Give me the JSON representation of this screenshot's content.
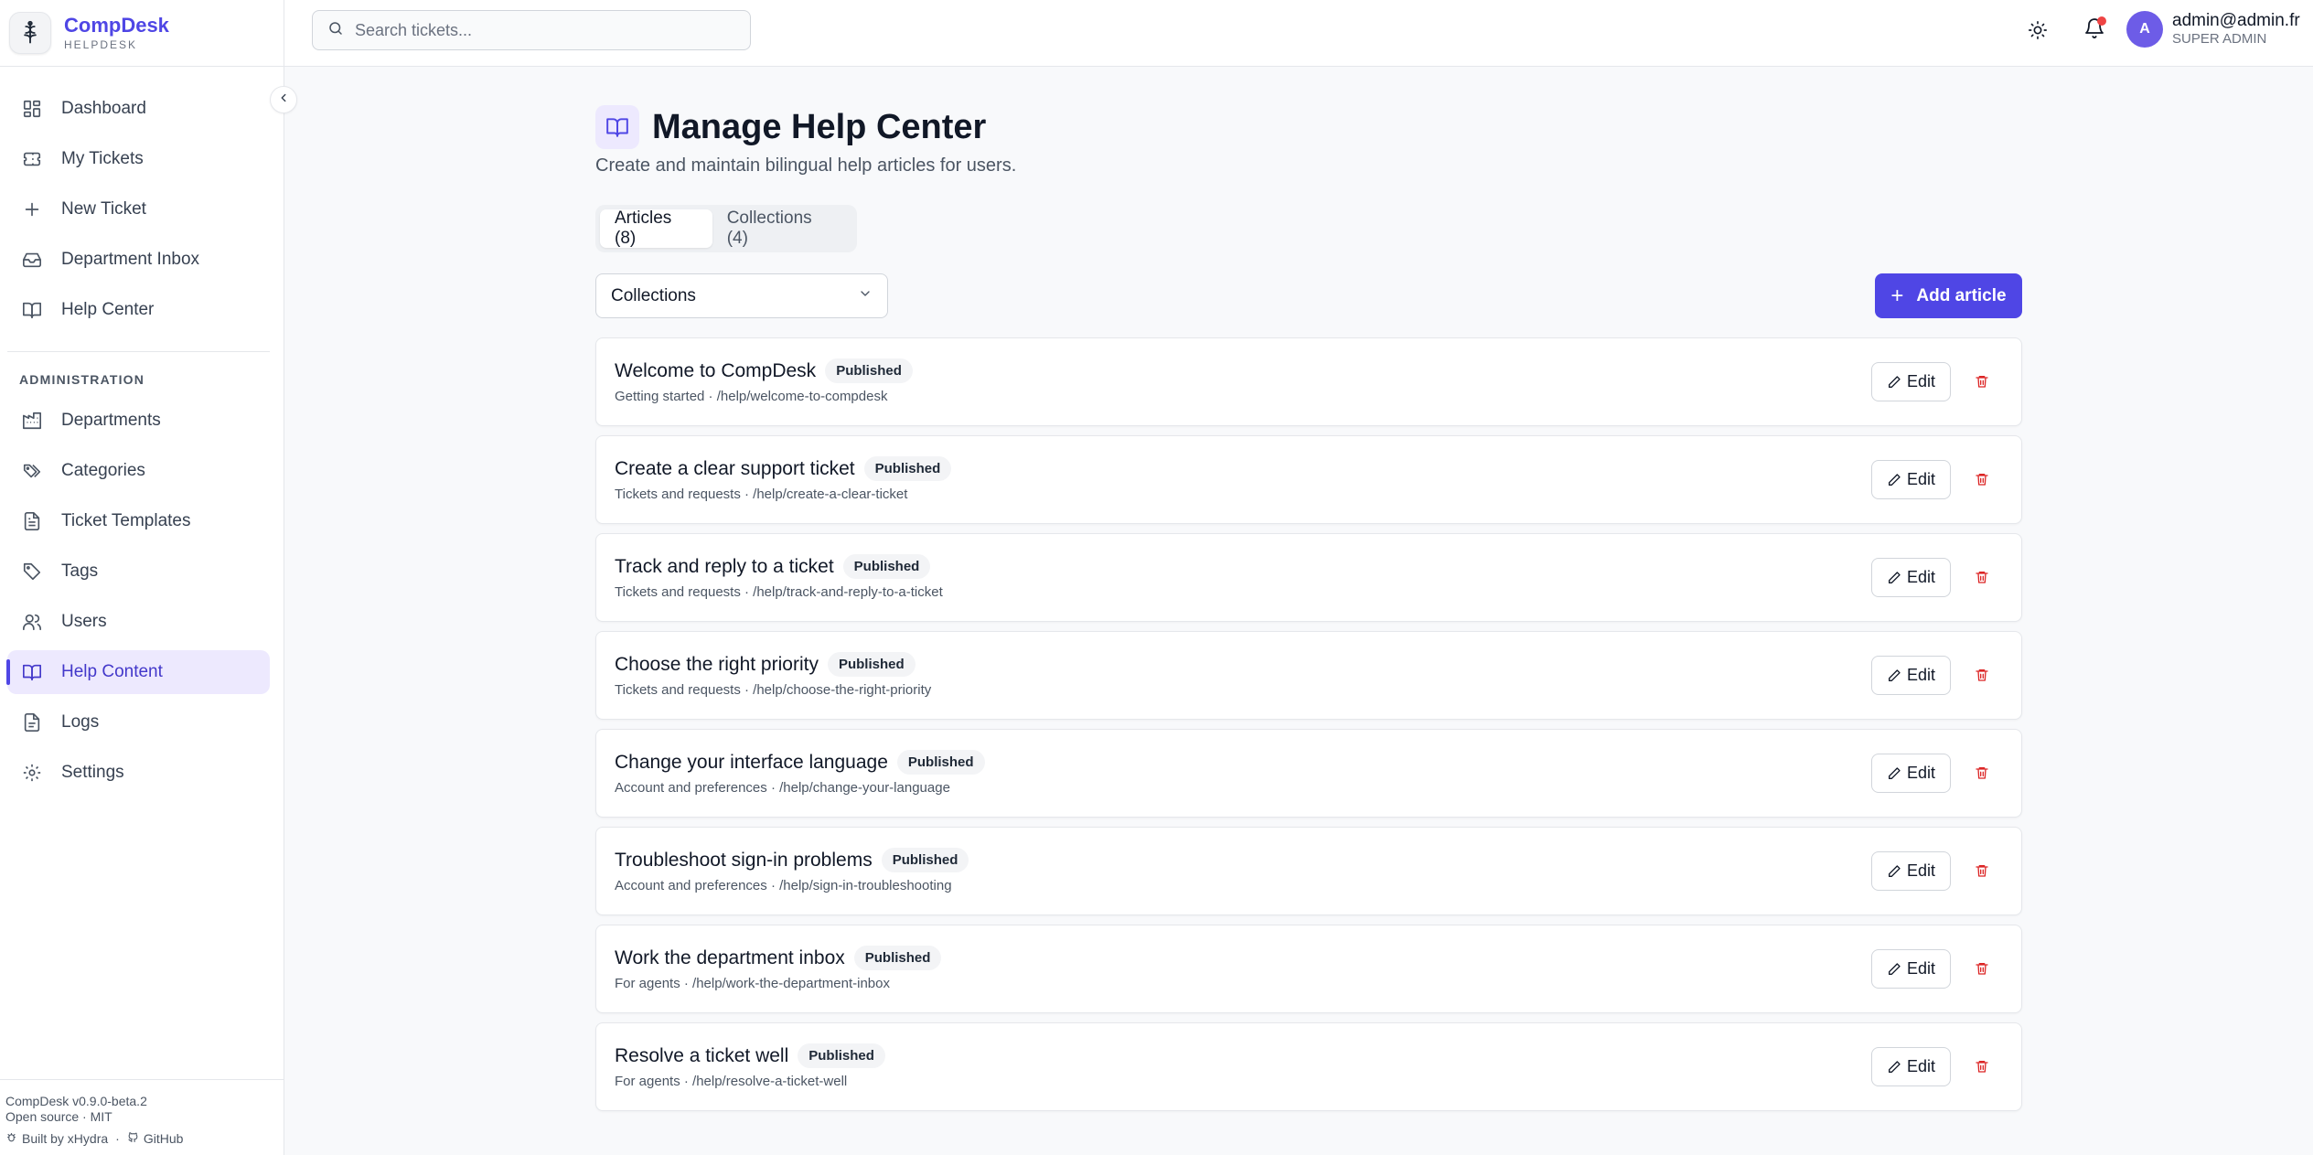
{
  "brand": {
    "name": "CompDesk",
    "subtitle": "HELPDESK"
  },
  "nav": {
    "main": [
      {
        "label": "Dashboard",
        "icon": "dashboard-icon"
      },
      {
        "label": "My Tickets",
        "icon": "ticket-icon"
      },
      {
        "label": "New Ticket",
        "icon": "plus-icon"
      },
      {
        "label": "Department Inbox",
        "icon": "inbox-icon"
      },
      {
        "label": "Help Center",
        "icon": "book-open-icon"
      }
    ],
    "section_label": "ADMINISTRATION",
    "admin": [
      {
        "label": "Departments",
        "icon": "building-icon"
      },
      {
        "label": "Categories",
        "icon": "tags-icon"
      },
      {
        "label": "Ticket Templates",
        "icon": "file-text-icon"
      },
      {
        "label": "Tags",
        "icon": "tag-icon"
      },
      {
        "label": "Users",
        "icon": "users-icon"
      },
      {
        "label": "Help Content",
        "icon": "book-open-icon",
        "active": true
      },
      {
        "label": "Logs",
        "icon": "file-lines-icon"
      },
      {
        "label": "Settings",
        "icon": "gear-icon"
      }
    ]
  },
  "footer": {
    "version": "CompDesk v0.9.0-beta.2",
    "license": "Open source · MIT",
    "built_by": "Built by xHydra",
    "github": "GitHub"
  },
  "header": {
    "search_placeholder": "Search tickets...",
    "user_initial": "A",
    "user_email": "admin@admin.fr",
    "user_role": "SUPER ADMIN"
  },
  "page": {
    "title": "Manage Help Center",
    "subtitle": "Create and maintain bilingual help articles for users.",
    "tabs": [
      {
        "label": "Articles (8)",
        "active": true
      },
      {
        "label": "Collections (4)",
        "active": false
      }
    ],
    "filter_value": "Collections",
    "add_button": "Add article",
    "edit_label": "Edit"
  },
  "articles": [
    {
      "title": "Welcome to CompDesk",
      "status": "Published",
      "meta": "Getting started · /help/welcome-to-compdesk"
    },
    {
      "title": "Create a clear support ticket",
      "status": "Published",
      "meta": "Tickets and requests · /help/create-a-clear-ticket"
    },
    {
      "title": "Track and reply to a ticket",
      "status": "Published",
      "meta": "Tickets and requests · /help/track-and-reply-to-a-ticket"
    },
    {
      "title": "Choose the right priority",
      "status": "Published",
      "meta": "Tickets and requests · /help/choose-the-right-priority"
    },
    {
      "title": "Change your interface language",
      "status": "Published",
      "meta": "Account and preferences · /help/change-your-language"
    },
    {
      "title": "Troubleshoot sign-in problems",
      "status": "Published",
      "meta": "Account and preferences · /help/sign-in-troubleshooting"
    },
    {
      "title": "Work the department inbox",
      "status": "Published",
      "meta": "For agents · /help/work-the-department-inbox"
    },
    {
      "title": "Resolve a ticket well",
      "status": "Published",
      "meta": "For agents · /help/resolve-a-ticket-well"
    }
  ]
}
